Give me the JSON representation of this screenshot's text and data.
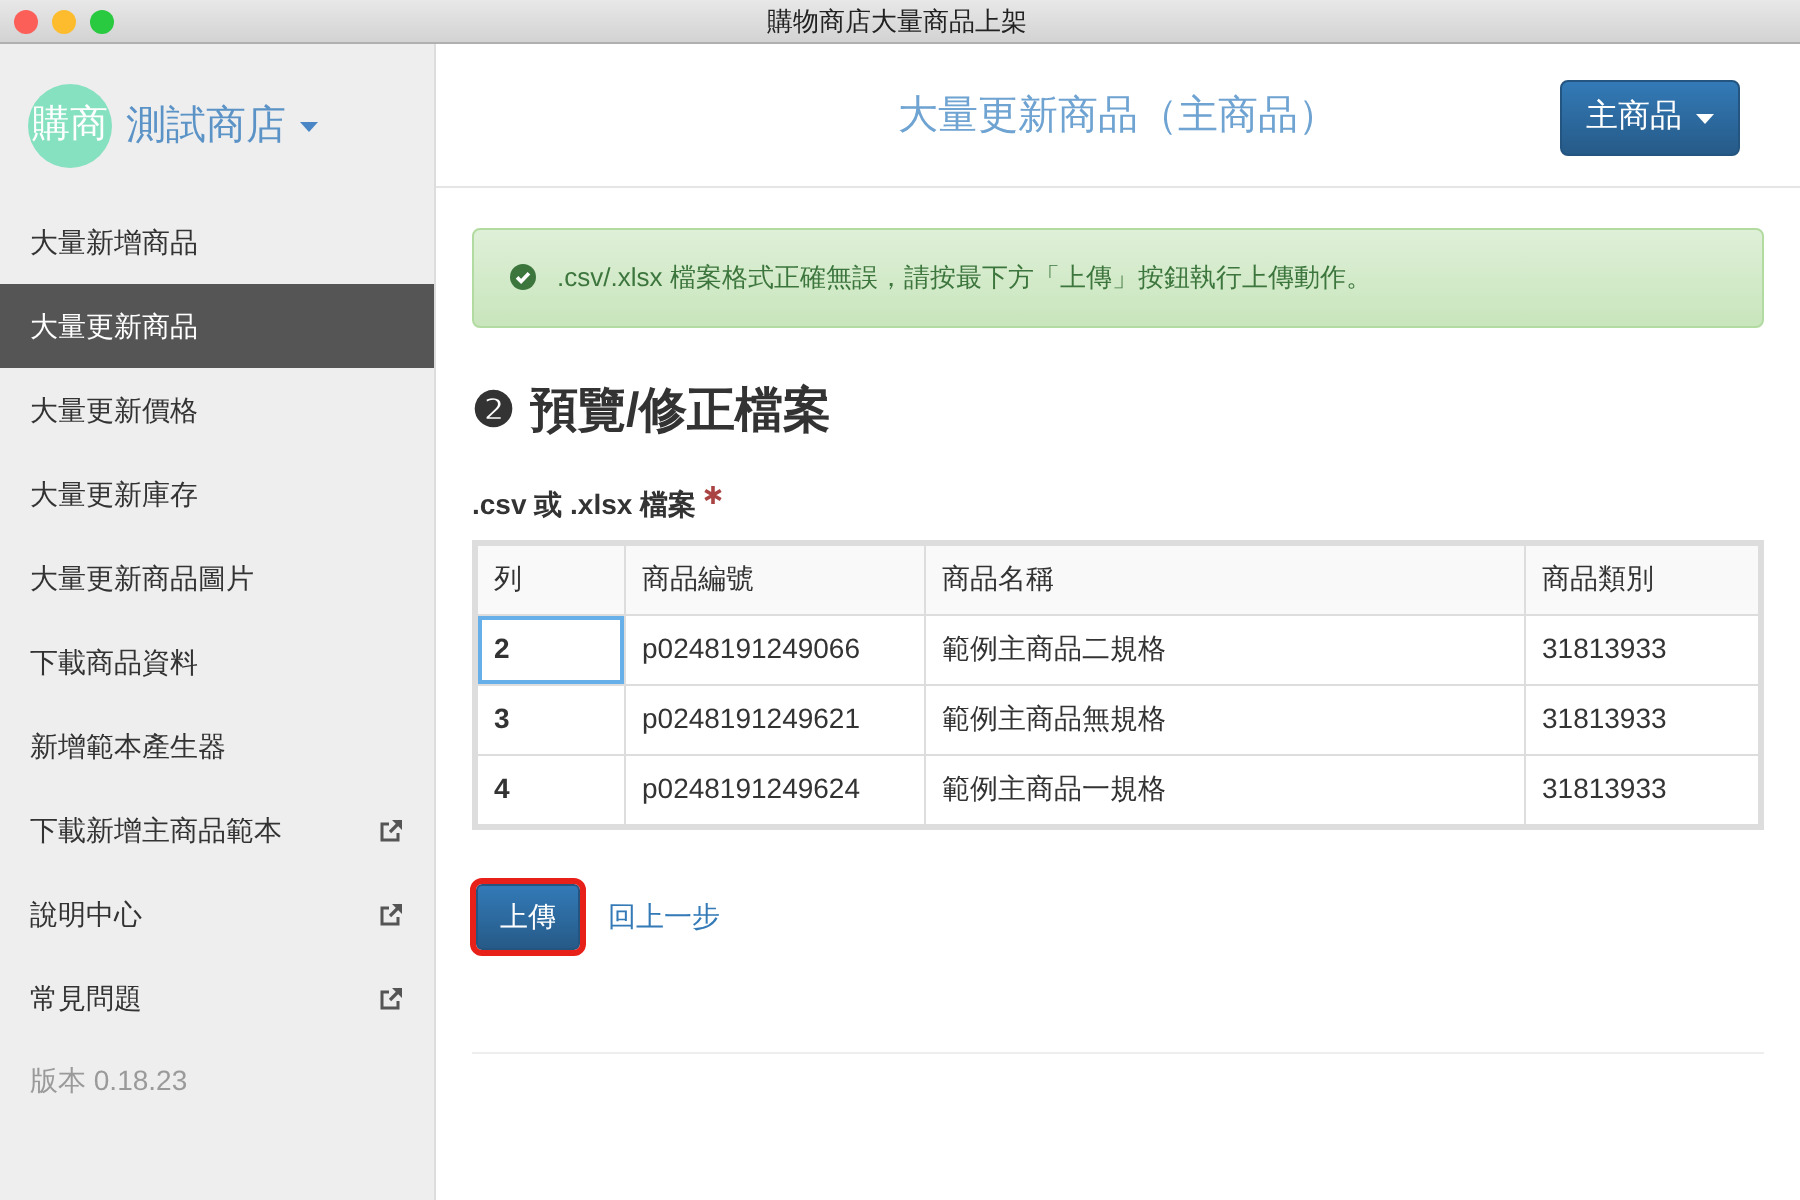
{
  "window": {
    "title": "購物商店大量商品上架"
  },
  "sidebar": {
    "avatar": "購商",
    "store": "測試商店",
    "items": [
      {
        "label": "大量新增商品",
        "kind": "link",
        "selected": false
      },
      {
        "label": "大量更新商品",
        "kind": "link",
        "selected": true
      },
      {
        "label": "大量更新價格",
        "kind": "link",
        "selected": false
      },
      {
        "label": "大量更新庫存",
        "kind": "link",
        "selected": false
      },
      {
        "label": "大量更新商品圖片",
        "kind": "link",
        "selected": false
      },
      {
        "label": "下載商品資料",
        "kind": "link",
        "selected": false
      },
      {
        "label": "新增範本產生器",
        "kind": "link",
        "selected": false
      },
      {
        "label": "下載新增主商品範本",
        "kind": "external",
        "selected": false
      },
      {
        "label": "說明中心",
        "kind": "external",
        "selected": false
      },
      {
        "label": "常見問題",
        "kind": "external",
        "selected": false
      }
    ],
    "version": "版本 0.18.23"
  },
  "header": {
    "title": "大量更新商品（主商品）",
    "dropdown": "主商品"
  },
  "alert": {
    "text": ".csv/.xlsx 檔案格式正確無誤，請按最下方「上傳」按鈕執行上傳動作。"
  },
  "section": {
    "number": "❷",
    "title": "預覽/修正檔案"
  },
  "field": {
    "label": ".csv 或 .xlsx 檔案",
    "required": true
  },
  "table": {
    "columns": [
      "列",
      "商品編號",
      "商品名稱",
      "商品類別"
    ],
    "rows": [
      {
        "cells": [
          "2",
          "p0248191249066",
          "範例主商品二規格",
          "31813933"
        ],
        "focused": true
      },
      {
        "cells": [
          "3",
          "p0248191249621",
          "範例主商品無規格",
          "31813933"
        ],
        "focused": false
      },
      {
        "cells": [
          "4",
          "p0248191249624",
          "範例主商品一規格",
          "31813933"
        ],
        "focused": false
      }
    ]
  },
  "actions": {
    "upload": "上傳",
    "upload_highlighted": true,
    "back": "回上一步"
  }
}
